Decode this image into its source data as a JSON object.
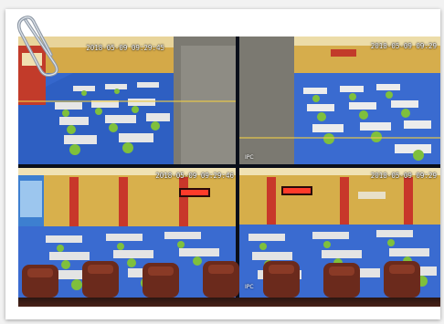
{
  "feeds": [
    {
      "id": "tl",
      "timestamp": "2018-05-09 09:29:45",
      "camera": ""
    },
    {
      "id": "tr",
      "timestamp": "2018-05-09 09:29",
      "camera": "IPC"
    },
    {
      "id": "bl",
      "timestamp": "2018-05-09 09:29:46",
      "camera": ""
    },
    {
      "id": "br",
      "timestamp": "2018-05-09 09:29",
      "camera": "IPC"
    }
  ],
  "colors": {
    "floor": "#2f63c8",
    "wall": "#d9b24a",
    "shirt": "#7fc03c",
    "seat": "#6b2a1c"
  },
  "icons": [
    "paperclip-icon"
  ]
}
